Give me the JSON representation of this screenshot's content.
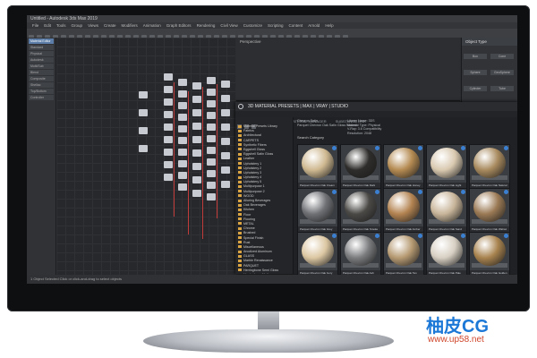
{
  "window": {
    "title": "Untitled - Autodesk 3ds Max 2019"
  },
  "menu": [
    "File",
    "Edit",
    "Tools",
    "Group",
    "Views",
    "Create",
    "Modifiers",
    "Animation",
    "Graph Editors",
    "Rendering",
    "Civil View",
    "Customize",
    "Scripting",
    "Content",
    "Arnold",
    "Help"
  ],
  "left_panel": {
    "items": [
      "Material Editor",
      "Standard",
      "Physical",
      "Autodesk",
      "Multi/Sub",
      "Blend",
      "Composite",
      "Shellac",
      "Top/Bottom",
      "Controller"
    ]
  },
  "viewport": {
    "label": "Perspective"
  },
  "command_panel": {
    "header": "Object Type",
    "buttons": [
      "Box",
      "Cone",
      "Sphere",
      "GeoSphere",
      "Cylinder",
      "Tube",
      "Torus",
      "Pyramid",
      "Teapot",
      "Plane"
    ]
  },
  "library": {
    "title": "3D MATERIAL PRESETS | MAX | VRAY | STUDIO",
    "tabs": [
      "MTL PRESETS LIBRARY",
      "MATERIAL MANAGER",
      "SUBSTANCE LINK"
    ],
    "tree": [
      "Material Presets Library",
      "Fabrics",
      "Architectural",
      "CARPETS",
      "Synthetic Fibers",
      "Eggshell Gloss",
      "Eggshell Satin Gloss",
      "Leather",
      "Upholstery 1",
      "Upholstery 2",
      "Upholstery 3",
      "Upholstery 4",
      "Upholstery 5",
      "Multipurpose 1",
      "Multipurpose 2",
      "WOOD",
      "Alluring Beverages",
      "Oak Beverages",
      "Kitchen",
      "Floor",
      "Flooring",
      "METAL",
      "Chrome",
      "Brushed",
      "Special Finish",
      "Rust",
      "Miscellaneous",
      "Anodized Aluminum",
      "GLASS",
      "Marble Renaissance",
      "PARQUET",
      "Herringbone Semi Gloss",
      "Herringbone Matt",
      "Herringbone Satin",
      "Herringbone Satin Gloss",
      "Rosa Wood Gloss",
      "Rosa Wood Matt",
      "Rosa Wood Satin",
      "Rosa Wood Lit Matt",
      "Chevron Satin Gloss",
      "Chevron Matt",
      "PARQUET RUSTIC",
      "Spanish Oak Gloss"
    ],
    "selected_tree_index": 39,
    "info": [
      "Chevron Satin",
      "Parquet Chevron Oak Satin Gloss Natural",
      "Library Name: 3DS",
      "Material Type: Physical",
      "V-Ray: 3.6 Compatibility",
      "Resolution: 2048"
    ],
    "search_label": "Search Category",
    "tiles": [
      {
        "name": "Parquet Chevron Oak Cream",
        "color": "#cfb991"
      },
      {
        "name": "Parquet Chevron Oak Dark",
        "color": "#2e2d2b"
      },
      {
        "name": "Parquet Chevron Oak Honey",
        "color": "#b58b52"
      },
      {
        "name": "Parquet Chevron Oak Light",
        "color": "#d9c9b0"
      },
      {
        "name": "Parquet Chevron Oak Natural",
        "color": "#a88a5e"
      },
      {
        "name": "Parquet Chevron Oak Grey",
        "color": "#6f7175"
      },
      {
        "name": "Parquet Chevron Oak Smoke",
        "color": "#4a4946"
      },
      {
        "name": "Parquet Chevron Oak Amber",
        "color": "#b48452"
      },
      {
        "name": "Parquet Chevron Oak Sand",
        "color": "#c8b59a"
      },
      {
        "name": "Parquet Chevron Oak Walnut",
        "color": "#9b7a55"
      },
      {
        "name": "Parquet Chevron Oak Ivory",
        "color": "#dcc7a2"
      },
      {
        "name": "Parquet Chevron Oak Ash",
        "color": "#7b7c7e"
      },
      {
        "name": "Parquet Chevron Oak Tan",
        "color": "#b69a72"
      },
      {
        "name": "Parquet Chevron Oak Pale",
        "color": "#d7cfc2"
      },
      {
        "name": "Parquet Chevron Oak Golden",
        "color": "#a8834f"
      }
    ]
  },
  "status": {
    "text": "1 Object Selected    Click or click-and-drag to select objects"
  },
  "brand": {
    "name": "柚皮CG",
    "url": "www.up58.net",
    "color": "#1c78d6"
  }
}
